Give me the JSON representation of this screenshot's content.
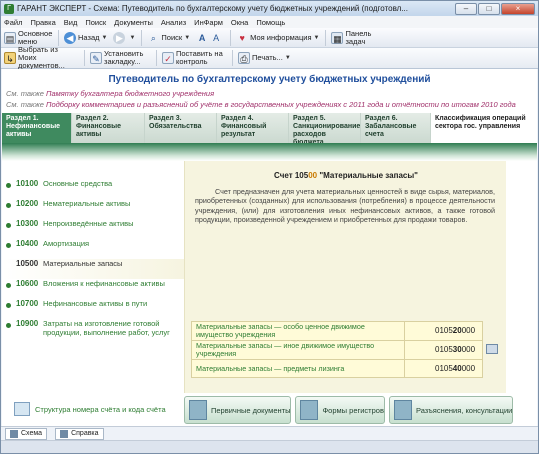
{
  "window": {
    "title": "ГАРАНТ ЭКСПЕРТ - Схема: Путеводитель по бухгалтерскому учету бюджетных учреждений (подготовл...",
    "controls": [
      "–",
      "□",
      "×"
    ]
  },
  "menu": [
    "Файл",
    "Правка",
    "Вид",
    "Поиск",
    "Документы",
    "Анализ",
    "ИнФарм",
    "Окна",
    "Помощь"
  ],
  "toolbar1": {
    "main_menu": "Основное меню",
    "back": "Назад",
    "search": "Поиск",
    "my_info": "Моя информация",
    "tasks_panel": "Панель задач"
  },
  "toolbar2": {
    "choose_docs": "Выбрать из Моих документов...",
    "set_bookmark": "Установить закладку...",
    "put_on_control": "Поставить на контроль",
    "print": "Печать..."
  },
  "guide": {
    "title": "Путеводитель по бухгалтерскому учету бюджетных учреждений",
    "see_also_1_prefix": "См. также ",
    "see_also_1_link": "Памятку",
    "see_also_1_rest": " бухгалтера бюджетного учреждения",
    "see_also_2_prefix": "См. также ",
    "see_also_2_link": "Подборку",
    "see_also_2_rest": " комментариев и разъяснений об учёте в государственных учреждениях с 2011 года и отчётности по итогам 2010 года"
  },
  "tabs": [
    {
      "label": "Раздел 1. Нефинансовые активы",
      "active": true
    },
    {
      "label": "Раздел 2. Финансовые активы",
      "active": false
    },
    {
      "label": "Раздел 3. Обязательства",
      "active": false
    },
    {
      "label": "Раздел 4. Финансовый результат",
      "active": false
    },
    {
      "label": "Раздел 5. Санкционирование расходов бюджета",
      "active": false
    },
    {
      "label": "Раздел 6. Забалансовые счета",
      "active": false
    },
    {
      "label": "Классификация операций сектора гос. управления",
      "active": false
    }
  ],
  "nav": [
    {
      "code": "10100",
      "label": "Основные средства",
      "active": false
    },
    {
      "code": "10200",
      "label": "Нематериальные активы",
      "active": false
    },
    {
      "code": "10300",
      "label": "Непроизведённые активы",
      "active": false
    },
    {
      "code": "10400",
      "label": "Амортизация",
      "active": false
    },
    {
      "code": "10500",
      "label": "Материальные запасы",
      "active": true
    },
    {
      "code": "10600",
      "label": "Вложения к нефинансовые активы",
      "active": false
    },
    {
      "code": "10700",
      "label": "Нефинансовые активы в пути",
      "active": false
    },
    {
      "code": "10900",
      "label": "Затраты на изготовление готовой продукции, выполнение работ, услуг",
      "active": false
    }
  ],
  "structure_link": "Структура номера счёта и кода счёта",
  "account": {
    "title_prefix": "Счет ",
    "code_part1": "105",
    "code_part2": "00",
    "title_suffix": " \"Материальные запасы\"",
    "description": "Счет предназначен для учета материальных ценностей в виде сырья, материалов, приобретенных (созданных) для использования (потребления) в процессе деятельности учреждения, (или) для изготовления иных нефинансовых активов, а также готовой продукции, произведенной учреждением и приобретенных для продажи товаров.",
    "rows": [
      {
        "label": "Материальные запасы — особо ценное движимое имущество учреждения",
        "num_pre": "0105",
        "num_bold": "20",
        "num_post": "000"
      },
      {
        "label": "Материальные запасы — иное движимое имущество учреждения",
        "num_pre": "0105",
        "num_bold": "30",
        "num_post": "000"
      },
      {
        "label": "Материальные запасы — предметы лизинга",
        "num_pre": "0105",
        "num_bold": "40",
        "num_post": "000"
      }
    ]
  },
  "bottom_buttons": [
    "Первичные документы",
    "Формы регистров",
    "Разъяснения, консультации"
  ],
  "status_tabs": [
    "Схема",
    "Справка"
  ]
}
